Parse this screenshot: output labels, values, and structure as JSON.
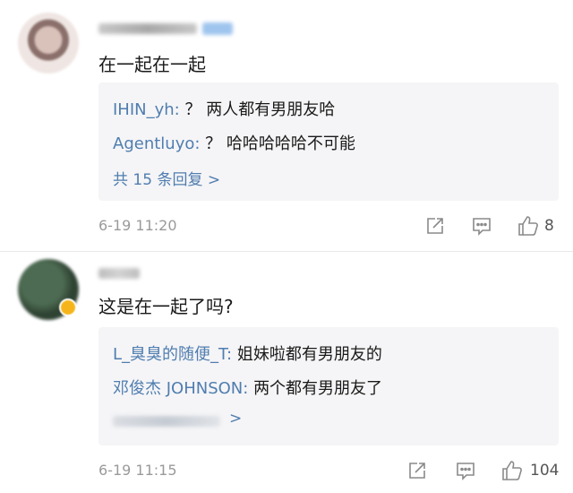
{
  "comments": [
    {
      "content": "在一起在一起",
      "replies": [
        {
          "who": "IHIN_yh:",
          "text": "？ 两人都有男朋友哈"
        },
        {
          "who": "Agentluyo:",
          "text": "？ 哈哈哈哈哈不可能"
        }
      ],
      "more": "共 15 条回复 >",
      "time": "6-19 11:20",
      "likes": "8"
    },
    {
      "content": "这是在一起了吗?",
      "replies": [
        {
          "who": "L_臭臭的随便_T:",
          "text": "姐妹啦都有男朋友的"
        },
        {
          "who": "邓俊杰 JOHNSON:",
          "text": "两个都有男朋友了"
        }
      ],
      "more_chevron": ">",
      "time": "6-19 11:15",
      "likes": "104"
    }
  ],
  "icons": {
    "share": "share-icon",
    "reply": "comment-icon",
    "like": "thumbs-up-icon"
  },
  "colors": {
    "link": "#507daf",
    "reply_bg": "#f5f5f7",
    "muted": "#9a9a9a"
  }
}
